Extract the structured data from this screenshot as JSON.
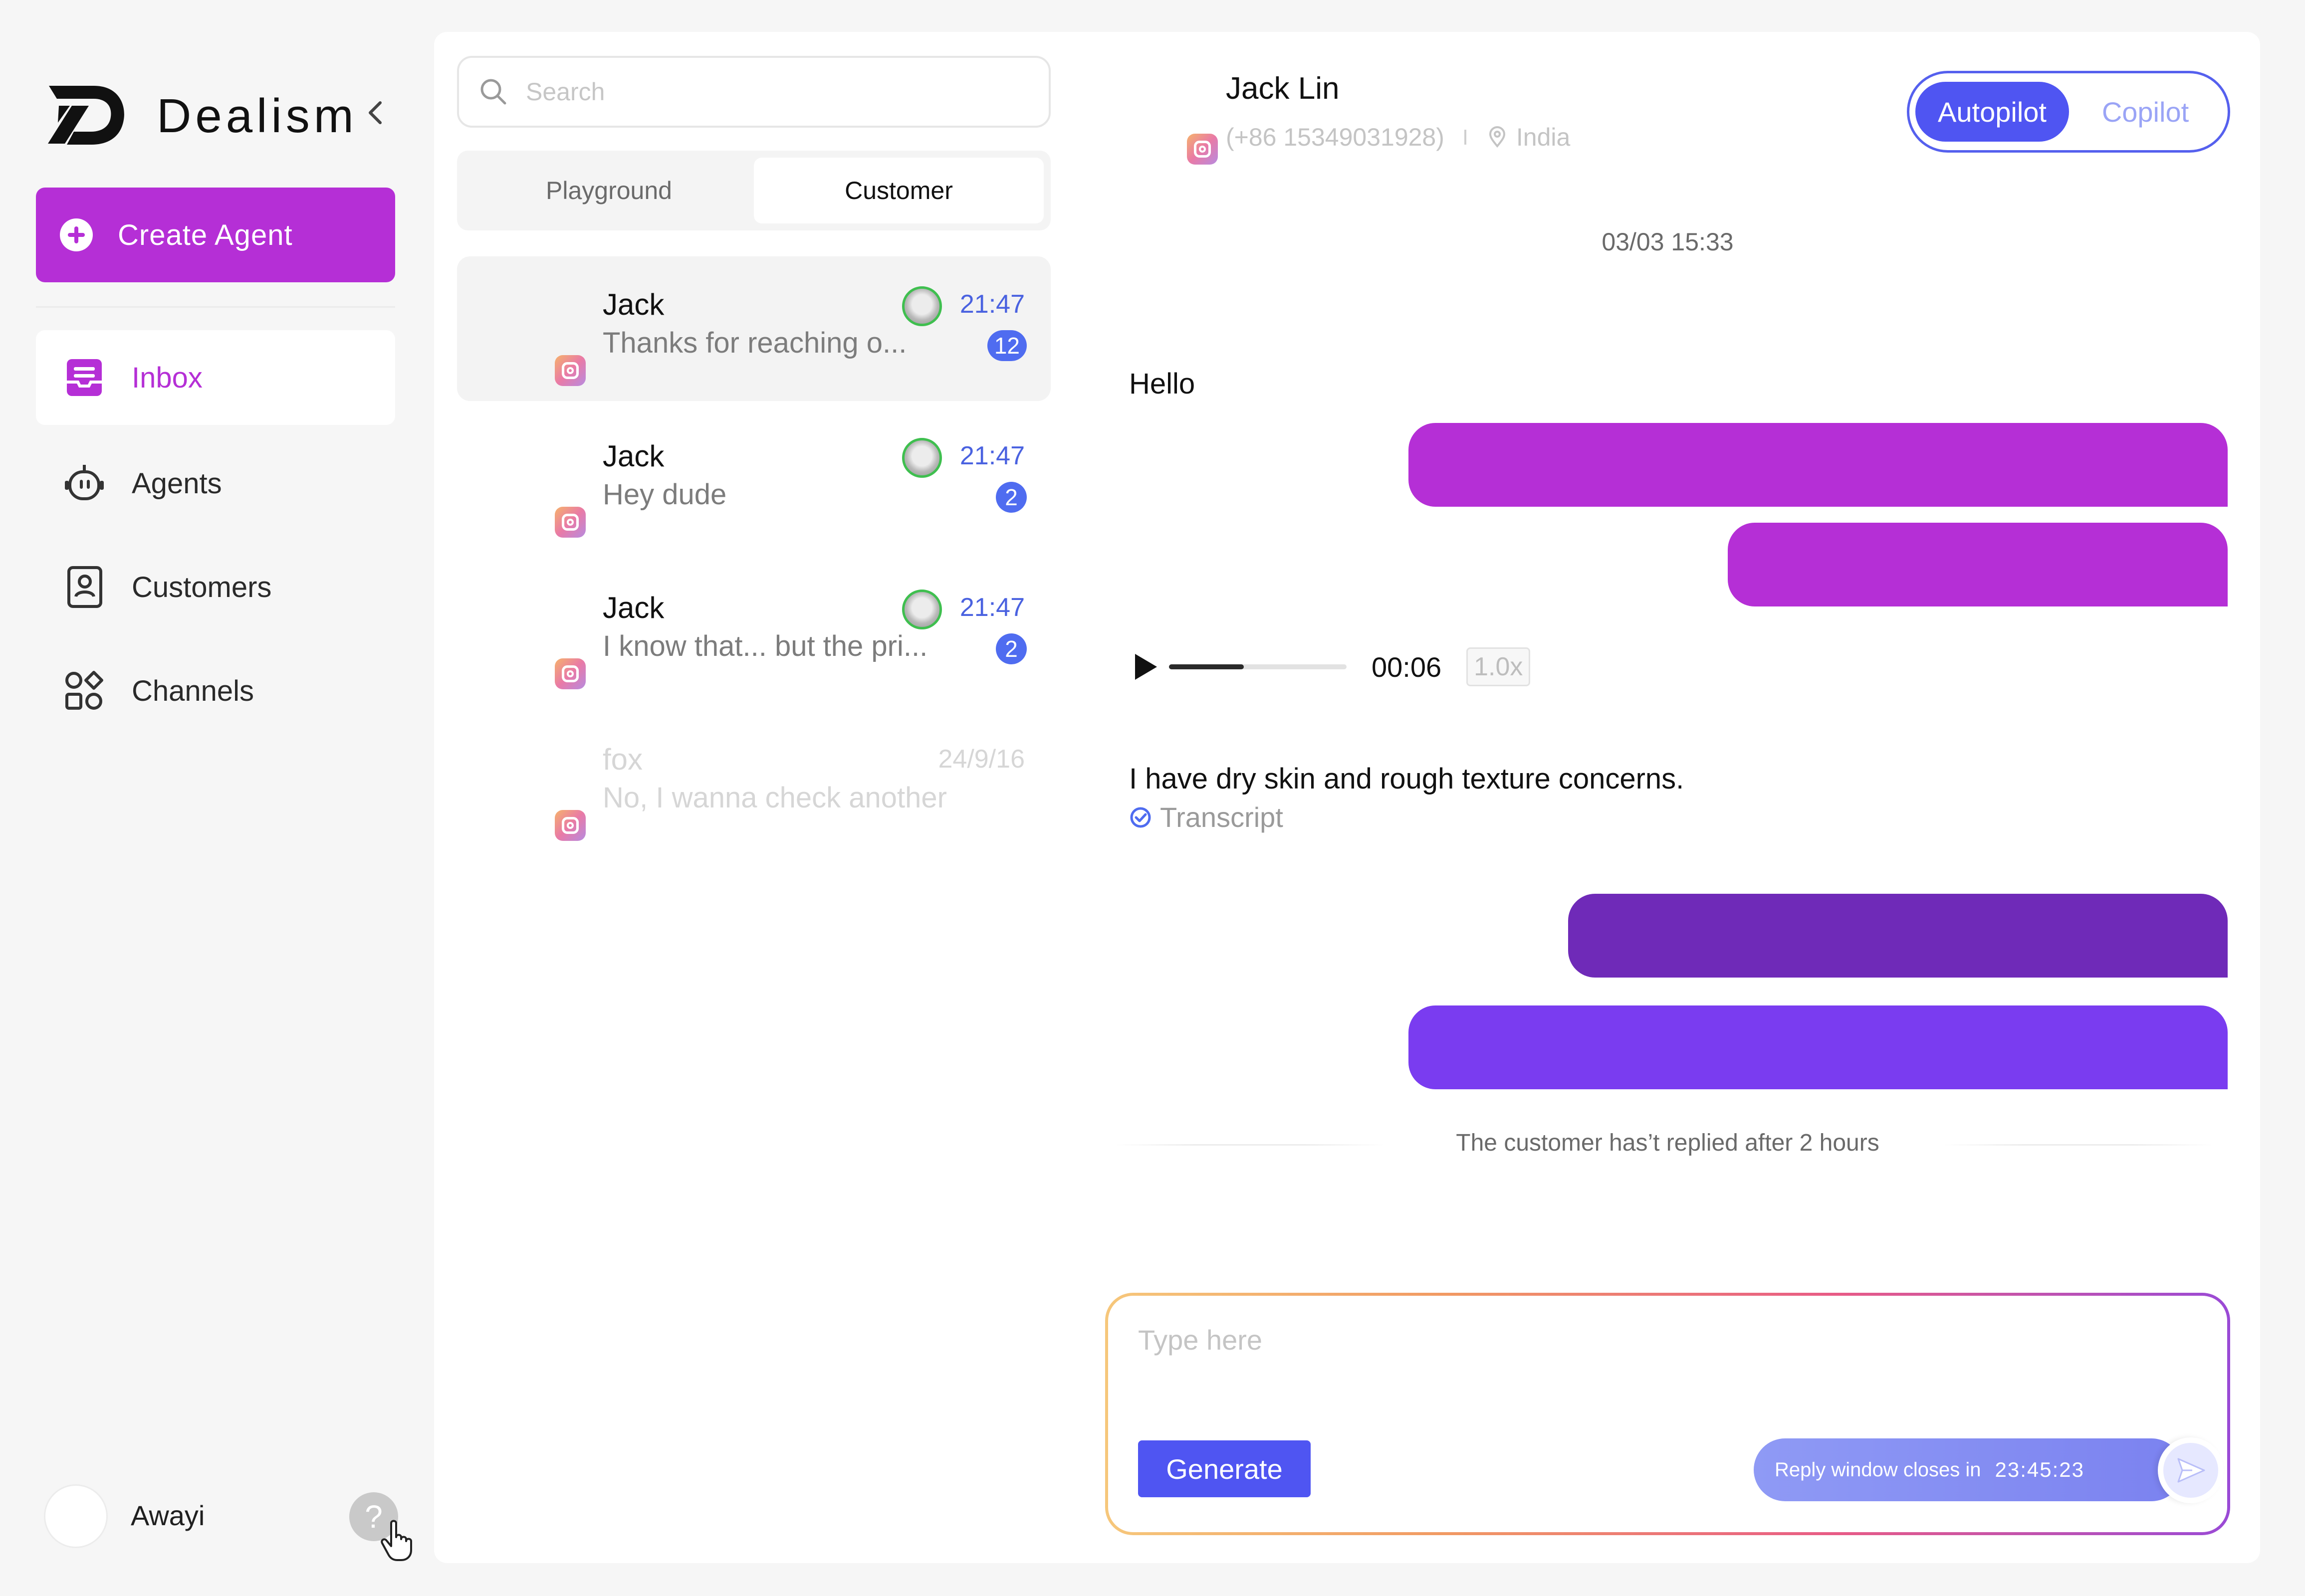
{
  "sidebar": {
    "brand": "Dealism",
    "create_agent_label": "Create Agent",
    "nav": [
      {
        "label": "Inbox",
        "icon": "inbox-icon",
        "active": true
      },
      {
        "label": "Agents",
        "icon": "robot-icon",
        "active": false
      },
      {
        "label": "Customers",
        "icon": "contact-book-icon",
        "active": false
      },
      {
        "label": "Channels",
        "icon": "channels-icon",
        "active": false
      }
    ],
    "user_name": "Awayi",
    "help_label": "?"
  },
  "list": {
    "search_placeholder": "Search",
    "tabs": [
      {
        "label": "Playground",
        "active": false
      },
      {
        "label": "Customer",
        "active": true
      }
    ],
    "conversations": [
      {
        "name": "Jack",
        "preview": "Thanks for reaching o...",
        "time": "21:47",
        "badge": "12",
        "channel": "instagram-icon"
      },
      {
        "name": "Jack",
        "preview": "Hey dude",
        "time": "21:47",
        "badge": "2",
        "channel": "instagram-icon"
      },
      {
        "name": "Jack",
        "preview": "I know that... but the pri...",
        "time": "21:47",
        "badge": "2",
        "channel": "instagram-icon"
      },
      {
        "name": "fox",
        "preview": "No, I wanna check another",
        "time": "24/9/16",
        "badge": "",
        "channel": "instagram-icon"
      }
    ]
  },
  "chat": {
    "contact_name": "Jack Lin",
    "phone": "(+86 15349031928)",
    "location": "India",
    "modes": [
      "Autopilot",
      "Copilot"
    ],
    "active_mode": "Autopilot",
    "date": "03/03 15:33",
    "messages": {
      "incoming_1": "Hello",
      "audio_duration": "00:06",
      "audio_speed": "1.0x",
      "audio_progress": 0.42,
      "incoming_2": "I have dry skin and rough texture concerns.",
      "transcript_label": "Transcript"
    },
    "bubble_colors": [
      "#b52fd6",
      "#b52fd6",
      "#6f2ab8",
      "#7a3cf0"
    ],
    "notice": "The customer has’t replied after 2 hours",
    "composer": {
      "placeholder": "Type here",
      "generate_label": "Generate",
      "reply_window_label": "Reply window closes in",
      "countdown": "23:45:23"
    }
  },
  "colors": {
    "accent": "#b52fd6",
    "primary_blue": "#4f55f2",
    "time_blue": "#4a62e0"
  }
}
